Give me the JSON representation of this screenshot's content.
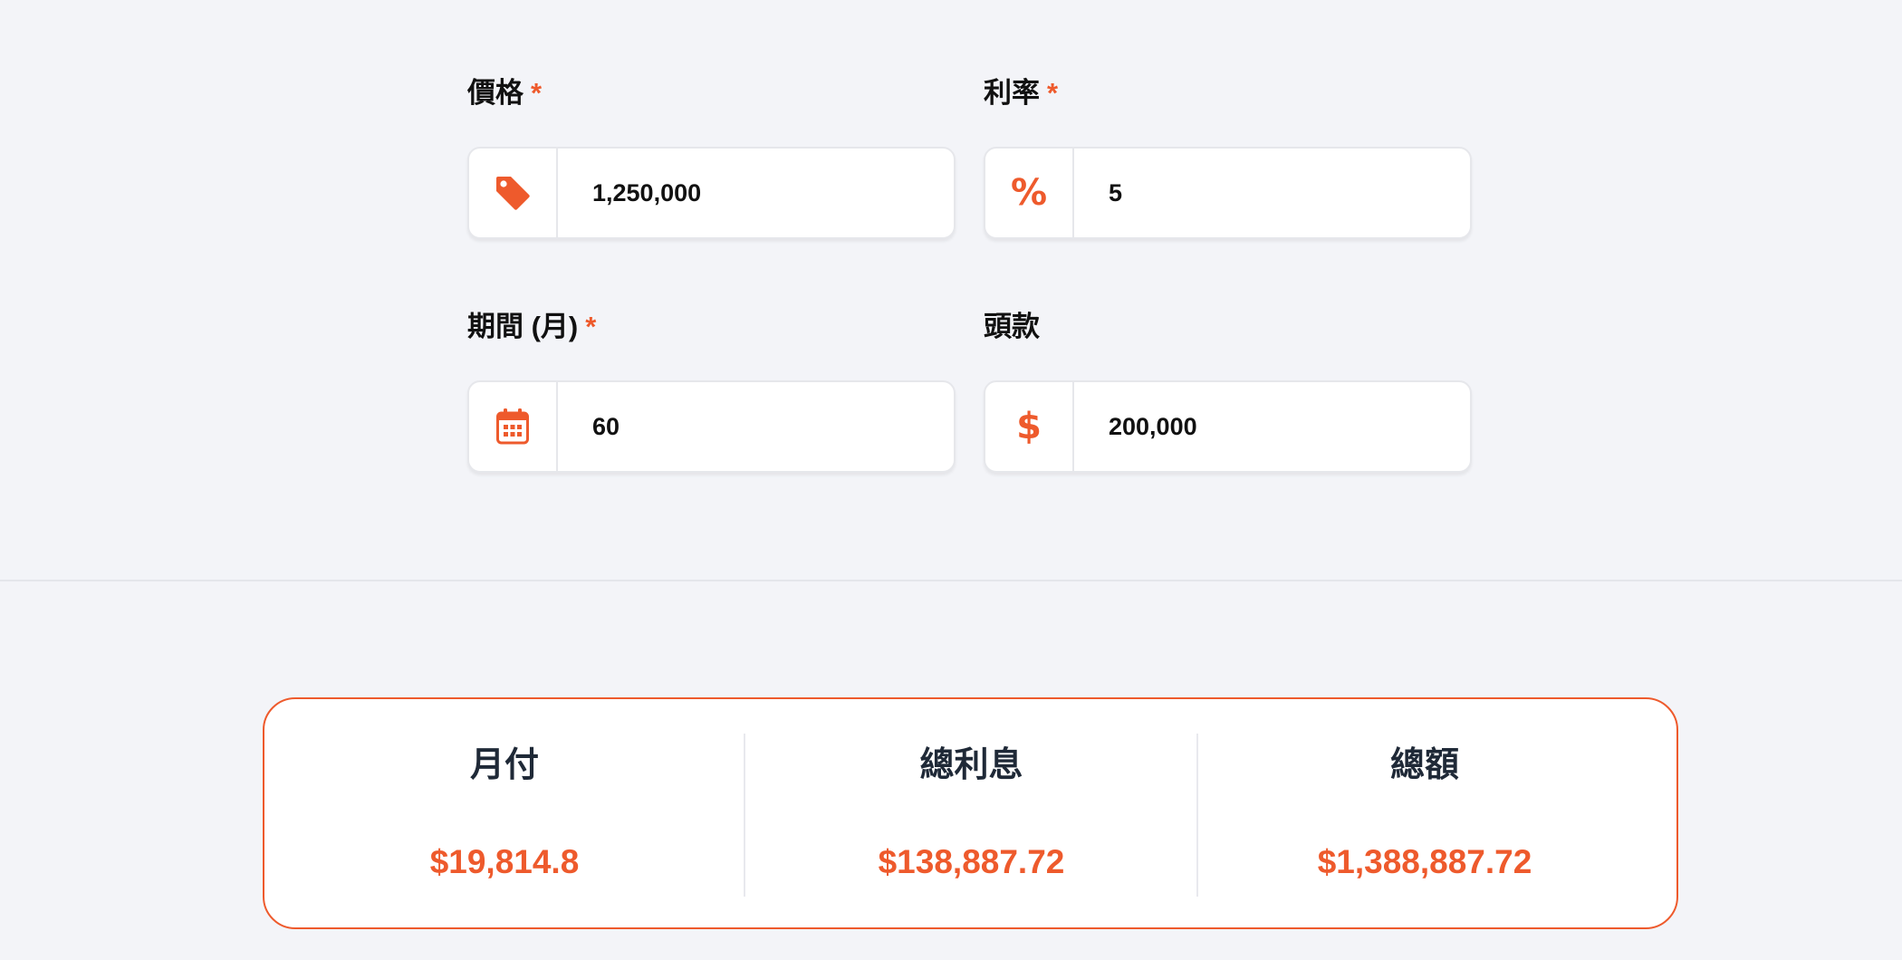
{
  "form": {
    "price": {
      "label": "價格",
      "required_mark": "*",
      "icon": "tag-icon",
      "value": "1,250,000"
    },
    "rate": {
      "label": "利率",
      "required_mark": "*",
      "icon": "percent-icon",
      "icon_glyph": "%",
      "value": "5"
    },
    "term": {
      "label": "期間 (月)",
      "required_mark": "*",
      "icon": "calendar-icon",
      "value": "60"
    },
    "down_payment": {
      "label": "頭款",
      "icon": "dollar-icon",
      "icon_glyph": "$",
      "value": "200,000"
    }
  },
  "results": {
    "monthly": {
      "label": "月付",
      "value": "$19,814.8"
    },
    "total_interest": {
      "label": "總利息",
      "value": "$138,887.72"
    },
    "total_amount": {
      "label": "總額",
      "value": "$1,388,887.72"
    }
  },
  "colors": {
    "accent": "#ee5a2c",
    "background": "#f3f4f8",
    "card": "#ffffff",
    "border": "#e6e7eb"
  }
}
